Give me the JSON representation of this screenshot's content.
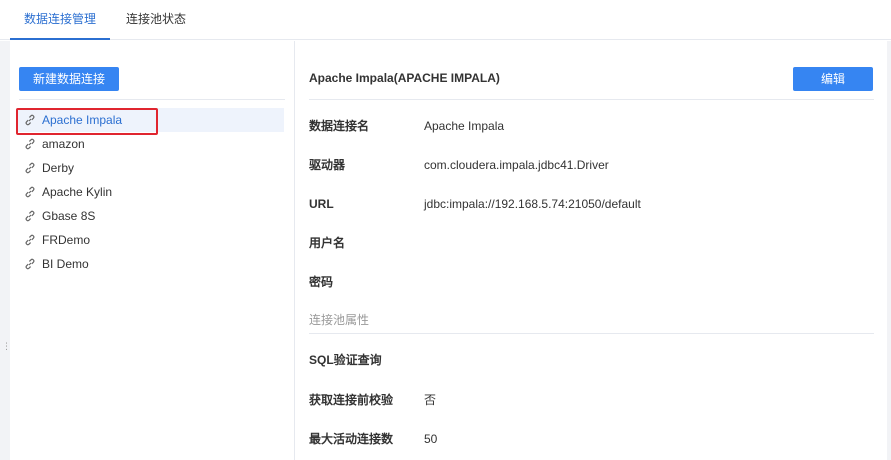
{
  "tabs": [
    {
      "label": "数据连接管理",
      "active": true
    },
    {
      "label": "连接池状态",
      "active": false
    }
  ],
  "left": {
    "new_button_label": "新建数据连接",
    "connections": [
      {
        "label": "Apache Impala",
        "selected": true
      },
      {
        "label": "amazon"
      },
      {
        "label": "Derby"
      },
      {
        "label": "Apache Kylin"
      },
      {
        "label": "Gbase 8S"
      },
      {
        "label": "FRDemo"
      },
      {
        "label": "BI Demo"
      }
    ],
    "icon": "link-icon"
  },
  "detail": {
    "title": "Apache Impala(APACHE IMPALA)",
    "edit_button_label": "编辑",
    "fields": [
      {
        "label": "数据连接名",
        "value": "Apache Impala"
      },
      {
        "label": "驱动器",
        "value": "com.cloudera.impala.jdbc41.Driver"
      },
      {
        "label": "URL",
        "value": "jdbc:impala://192.168.5.74:21050/default"
      },
      {
        "label": "用户名",
        "value": ""
      },
      {
        "label": "密码",
        "value": ""
      }
    ],
    "pool_section_title": "连接池属性",
    "pool_fields": [
      {
        "label": "SQL验证查询",
        "value": ""
      },
      {
        "label": "获取连接前校验",
        "value": "否"
      },
      {
        "label": "最大活动连接数",
        "value": "50"
      }
    ]
  },
  "colors": {
    "accent": "#3685f2",
    "active_tab": "#2b6fd1",
    "highlight": "#e0252f",
    "selected_bg": "#eef3fc"
  }
}
